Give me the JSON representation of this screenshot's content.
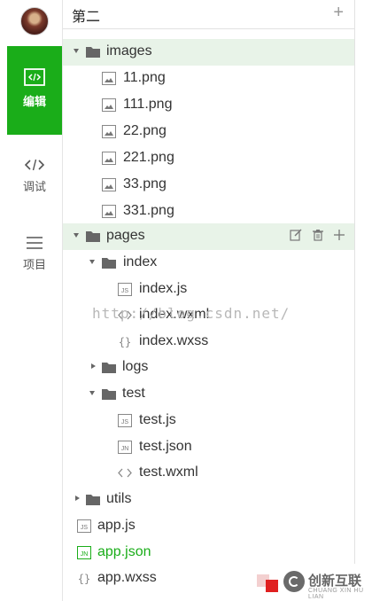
{
  "sidebar": {
    "items": [
      {
        "label": "编辑",
        "active": true,
        "icon": "code-editor-icon"
      },
      {
        "label": "调试",
        "active": false,
        "icon": "code-brackets-icon"
      },
      {
        "label": "项目",
        "active": false,
        "icon": "menu-lines-icon"
      }
    ]
  },
  "header": {
    "title": "第二",
    "add_icon": "plus-icon"
  },
  "tree": {
    "images_folder": "images",
    "images_files": [
      "11.png",
      "111.png",
      "22.png",
      "221.png",
      "33.png",
      "331.png"
    ],
    "pages_folder": "pages",
    "index_folder": "index",
    "index_files": [
      "index.js",
      "index.wxml",
      "index.wxss"
    ],
    "logs_folder": "logs",
    "test_folder": "test",
    "test_files": [
      "test.js",
      "test.json",
      "test.wxml"
    ],
    "utils_folder": "utils",
    "root_files": [
      "app.js",
      "app.json",
      "app.wxss"
    ]
  },
  "watermark": "http://blog.csdn.net/",
  "logo": {
    "name": "创新互联",
    "sub": "CHUANG XIN HU LIAN"
  },
  "colors": {
    "accent": "#1aad19",
    "highlight_row": "#e8f3e8"
  }
}
